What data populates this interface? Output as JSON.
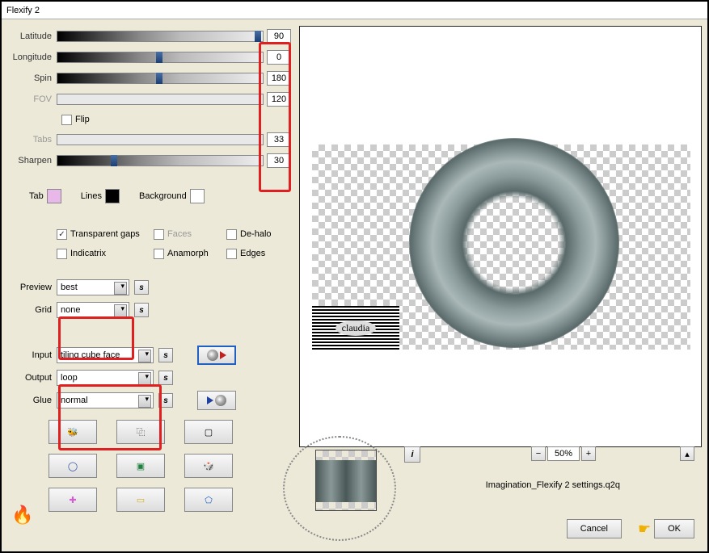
{
  "window": {
    "title": "Flexify 2"
  },
  "sliders": {
    "latitude": {
      "label": "Latitude",
      "value": "90",
      "disabled": false,
      "thumb_pct": 96
    },
    "longitude": {
      "label": "Longitude",
      "value": "0",
      "disabled": false,
      "thumb_pct": 48
    },
    "spin": {
      "label": "Spin",
      "value": "180",
      "disabled": false,
      "thumb_pct": 48
    },
    "fov": {
      "label": "FOV",
      "value": "120",
      "disabled": true,
      "thumb_pct": 0
    },
    "tabs": {
      "label": "Tabs",
      "value": "33",
      "disabled": true,
      "thumb_pct": 0
    },
    "sharpen": {
      "label": "Sharpen",
      "value": "30",
      "disabled": false,
      "thumb_pct": 26
    }
  },
  "flip": {
    "label": "Flip",
    "checked": false
  },
  "colors": {
    "tab": {
      "label": "Tab",
      "color": "#e8b8e8"
    },
    "lines": {
      "label": "Lines",
      "color": "#000000"
    },
    "background": {
      "label": "Background",
      "color": "#ffffff"
    }
  },
  "checks": {
    "transparent_gaps": {
      "label": "Transparent gaps",
      "checked": true,
      "disabled": false
    },
    "faces": {
      "label": "Faces",
      "checked": false,
      "disabled": true
    },
    "dehalo": {
      "label": "De-halo",
      "checked": false,
      "disabled": false
    },
    "indicatrix": {
      "label": "Indicatrix",
      "checked": false,
      "disabled": false
    },
    "anamorph": {
      "label": "Anamorph",
      "checked": false,
      "disabled": false
    },
    "edges": {
      "label": "Edges",
      "checked": false,
      "disabled": false
    }
  },
  "dropdowns": {
    "preview": {
      "label": "Preview",
      "value": "best"
    },
    "grid": {
      "label": "Grid",
      "value": "none"
    },
    "input": {
      "label": "Input",
      "value": "tiling cube face"
    },
    "output": {
      "label": "Output",
      "value": "loop"
    },
    "glue": {
      "label": "Glue",
      "value": "normal"
    }
  },
  "zoom": {
    "value": "50%"
  },
  "filename": "Imagination_Flexify 2 settings.q2q",
  "buttons": {
    "cancel": "Cancel",
    "ok": "OK"
  },
  "watermark": "claudia"
}
